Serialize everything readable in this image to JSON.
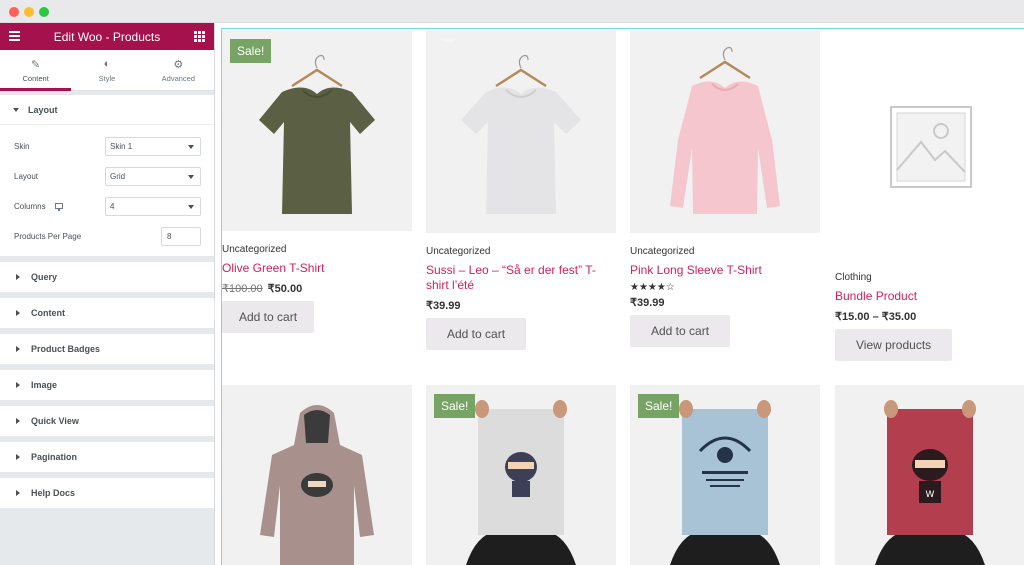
{
  "sidebar": {
    "title": "Edit Woo - Products",
    "tabs": [
      {
        "label": "Content",
        "icon": "pencil-icon"
      },
      {
        "label": "Style",
        "icon": "half-circle-icon"
      },
      {
        "label": "Advanced",
        "icon": "gear-icon"
      }
    ],
    "layout_section": {
      "title": "Layout",
      "skin_label": "Skin",
      "skin_value": "Skin 1",
      "layout_label": "Layout",
      "layout_value": "Grid",
      "columns_label": "Columns",
      "columns_value": "4",
      "per_page_label": "Products Per Page",
      "per_page_value": "8"
    },
    "sections": [
      "Query",
      "Content",
      "Product Badges",
      "Image",
      "Quick View",
      "Pagination",
      "Help Docs"
    ]
  },
  "products": [
    {
      "sale_badge": "Sale!",
      "category": "Uncategorized",
      "name": "Olive Green T-Shirt",
      "old_price": "₹100.00",
      "price": "₹50.00",
      "button": "Add to cart"
    },
    {
      "sale_badge": "Sale!",
      "category": "Uncategorized",
      "name": "Sussi – Leo – “Så er der fest” T-shirt l’été",
      "price": "₹39.99",
      "button": "Add to cart"
    },
    {
      "category": "Uncategorized",
      "name": "Pink Long Sleeve T-Shirt",
      "rating": 4,
      "stars": "★★★★☆",
      "price": "₹39.99",
      "button": "Add to cart"
    },
    {
      "category": "Clothing",
      "name": "Bundle Product",
      "price": "₹15.00 – ₹35.00",
      "button": "View products"
    },
    {},
    {
      "sale_badge": "Sale!"
    },
    {
      "sale_badge": "Sale!"
    },
    {}
  ],
  "colors": {
    "accent": "#a4114d",
    "link": "#d4205e",
    "sale": "#77a464"
  }
}
